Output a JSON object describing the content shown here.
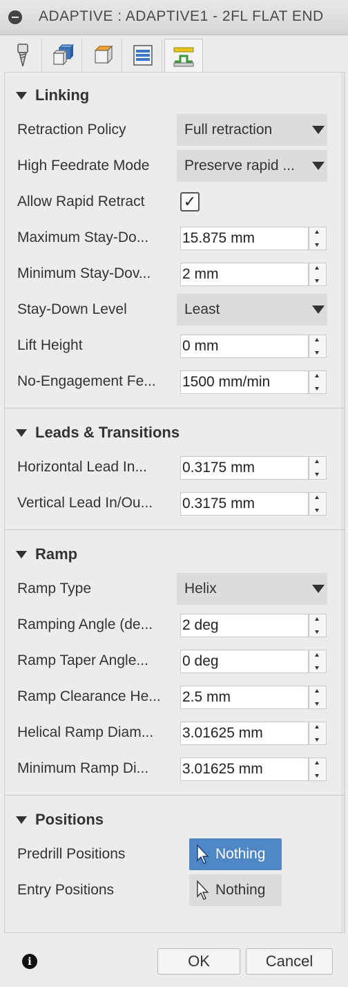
{
  "window": {
    "title": "ADAPTIVE : ADAPTIVE1 - 2FL FLAT END"
  },
  "tabs": [
    {
      "icon": "tool-icon"
    },
    {
      "icon": "geometry-icon"
    },
    {
      "icon": "heights-icon"
    },
    {
      "icon": "passes-icon"
    },
    {
      "icon": "linking-icon",
      "active": true
    }
  ],
  "linking": {
    "header": "Linking",
    "retraction_policy": {
      "label": "Retraction Policy",
      "value": "Full retraction"
    },
    "high_feedrate_mode": {
      "label": "High Feedrate Mode",
      "value": "Preserve rapid ..."
    },
    "allow_rapid_retract": {
      "label": "Allow Rapid Retract",
      "checked": true,
      "glyph": "✓"
    },
    "max_stay_down": {
      "label": "Maximum Stay-Do...",
      "value": "15.875 mm"
    },
    "min_stay_down": {
      "label": "Minimum Stay-Dov...",
      "value": "2 mm"
    },
    "stay_down_level": {
      "label": "Stay-Down Level",
      "value": "Least"
    },
    "lift_height": {
      "label": "Lift Height",
      "value": "0 mm"
    },
    "no_engagement": {
      "label": "No-Engagement Fe...",
      "value": "1500 mm/min"
    }
  },
  "leads": {
    "header": "Leads & Transitions",
    "horizontal": {
      "label": "Horizontal Lead In...",
      "value": "0.3175 mm"
    },
    "vertical": {
      "label": "Vertical Lead In/Ou...",
      "value": "0.3175 mm"
    }
  },
  "ramp": {
    "header": "Ramp",
    "ramp_type": {
      "label": "Ramp Type",
      "value": "Helix"
    },
    "ramping_angle": {
      "label": "Ramping Angle (de...",
      "value": "2 deg"
    },
    "taper_angle": {
      "label": "Ramp Taper Angle...",
      "value": "0 deg"
    },
    "clearance": {
      "label": "Ramp Clearance He...",
      "value": "2.5 mm"
    },
    "helical_diam": {
      "label": "Helical Ramp Diam...",
      "value": "3.01625 mm"
    },
    "min_diam": {
      "label": "Minimum Ramp Di...",
      "value": "3.01625 mm"
    }
  },
  "positions": {
    "header": "Positions",
    "predrill": {
      "label": "Predrill Positions",
      "value": "Nothing",
      "active": true
    },
    "entry": {
      "label": "Entry Positions",
      "value": "Nothing"
    }
  },
  "footer": {
    "ok": "OK",
    "cancel": "Cancel",
    "info_glyph": "i"
  },
  "colors": {
    "accent": "#4f86c6",
    "tab_icon_blue": "#3b78c4",
    "tab_icon_green": "#3a9a3a",
    "tab_icon_yellow": "#e8c51c"
  }
}
